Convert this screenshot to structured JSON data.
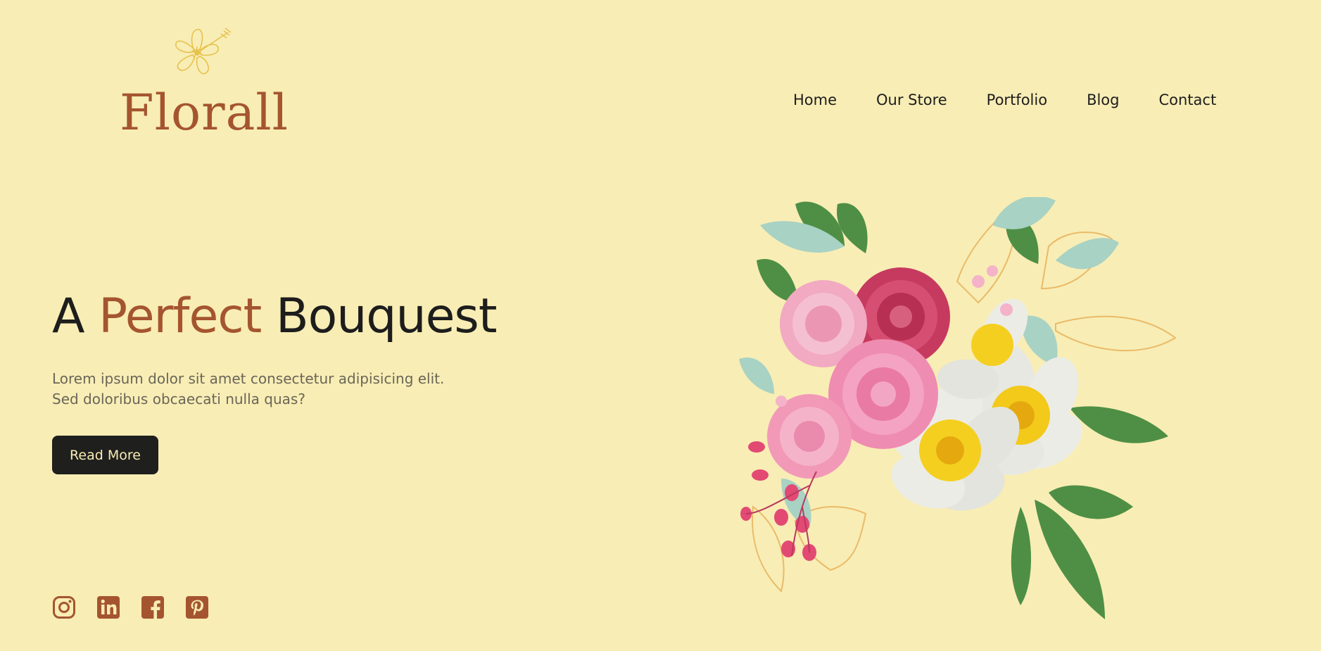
{
  "brand": {
    "name": "Florall",
    "accent": "#a4552f",
    "background": "#f8edb5",
    "logo_icon": "hibiscus-icon"
  },
  "nav": {
    "items": [
      {
        "label": "Home"
      },
      {
        "label": "Our Store"
      },
      {
        "label": "Portfolio"
      },
      {
        "label": "Blog"
      },
      {
        "label": "Contact"
      }
    ]
  },
  "hero": {
    "title_part1": "A ",
    "title_accent": "Perfect",
    "title_part2": " Bouquest",
    "desc_line1": "Lorem ipsum dolor sit amet consectetur adipisicing elit.",
    "desc_line2": "Sed doloribus obcaecati nulla quas?",
    "button_label": "Read More",
    "image": "flower-bouquet-illustration"
  },
  "socials": [
    {
      "icon": "instagram-icon"
    },
    {
      "icon": "linkedin-icon"
    },
    {
      "icon": "facebook-icon"
    },
    {
      "icon": "pinterest-icon"
    }
  ]
}
